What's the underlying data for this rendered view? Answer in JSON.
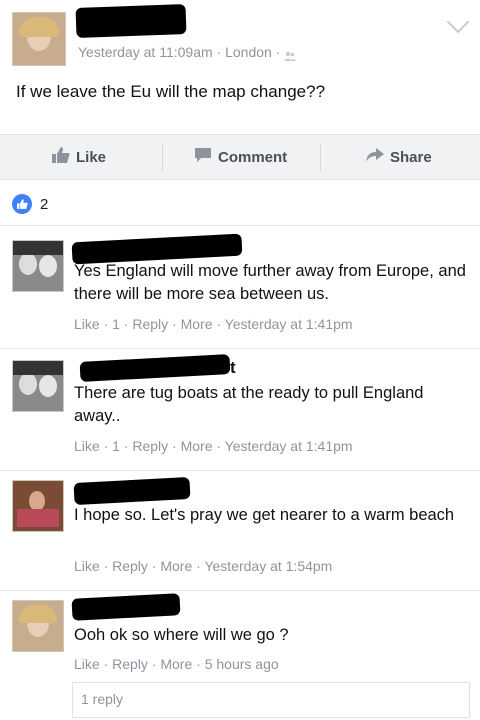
{
  "post": {
    "timestamp": "Yesterday at 11:09am",
    "location": "London",
    "text": "If we leave the Eu will the map change??"
  },
  "actions": {
    "like": "Like",
    "comment": "Comment",
    "share": "Share"
  },
  "reactions": {
    "count": "2"
  },
  "comments": [
    {
      "name_fragment": "",
      "text": "Yes England will move further away from Europe, and there will be more sea between us.",
      "meta": "Like · 1 · Reply · More · Yesterday at 1:41pm"
    },
    {
      "name_fragment": "t",
      "text": "There are tug boats at the ready to pull England away..",
      "meta": "Like · 1 · Reply · More · Yesterday at 1:41pm"
    },
    {
      "name_fragment": "",
      "text": "I hope so. Let's pray we get nearer to a warm beach",
      "meta": "Like · Reply · More · Yesterday at 1:54pm"
    },
    {
      "name_fragment": "",
      "text": "Ooh ok so where will we go ?",
      "meta": "Like · Reply · More · 5 hours ago"
    }
  ],
  "replies": {
    "label": "1 reply"
  },
  "colors": {
    "like_blue": "#4080ff",
    "meta_gray": "#90949c",
    "action_gray": "#4b4f56"
  }
}
